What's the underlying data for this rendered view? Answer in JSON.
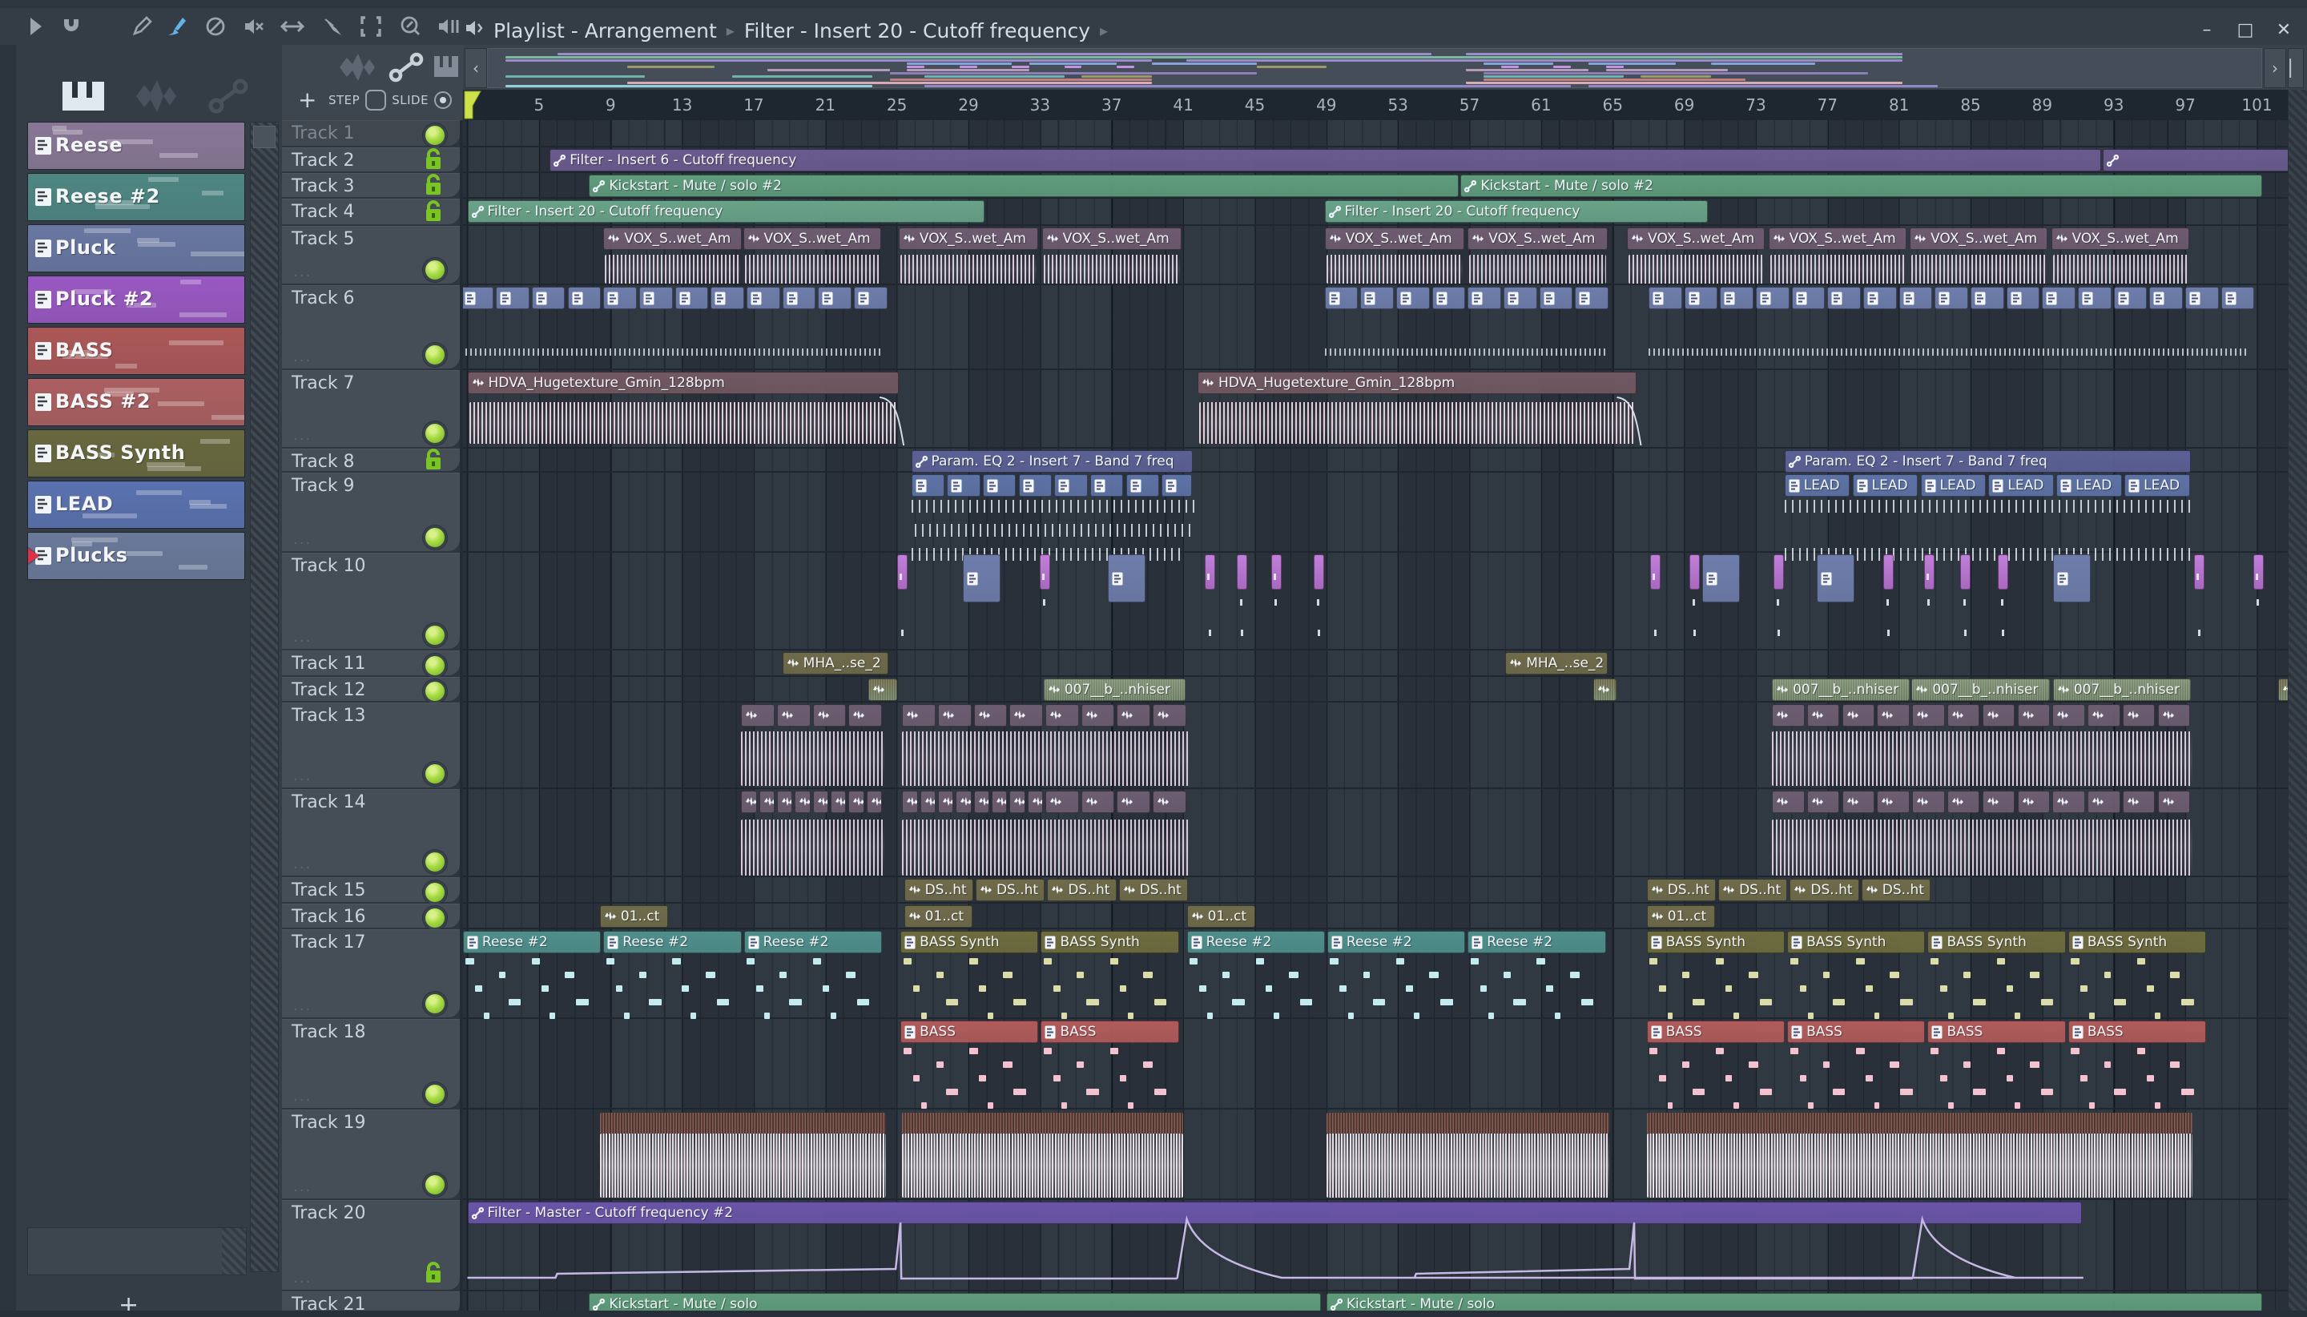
{
  "window": {
    "title_left": "Playlist - Arrangement",
    "title_right": "Filter - Insert 20 - Cutoff frequency",
    "controls": [
      "minimize",
      "maximize",
      "close"
    ]
  },
  "toolbar": {
    "icons": [
      "play",
      "magnet",
      "draw",
      "paint",
      "delete",
      "mute",
      "slip",
      "slice",
      "select",
      "zoom",
      "playback"
    ],
    "active_icon": "paint",
    "accent": "#63b3e8"
  },
  "corner": {
    "add_label": "+",
    "step_label": "STEP",
    "slide_label": "SLIDE",
    "icons": [
      "audio-wave",
      "automation-link",
      "piano"
    ],
    "slide_on": true,
    "step_on": false
  },
  "sidebar": {
    "header_icons": [
      "piano",
      "audio-wave",
      "automation-link"
    ],
    "patterns": [
      {
        "name": "Reese",
        "color": "#8d7a99"
      },
      {
        "name": "Reese #2",
        "color": "#4f8a85"
      },
      {
        "name": "Pluck",
        "color": "#6b7aa6"
      },
      {
        "name": "Pluck #2",
        "color": "#9e59c8"
      },
      {
        "name": "BASS",
        "color": "#b25858"
      },
      {
        "name": "BASS #2",
        "color": "#b26161"
      },
      {
        "name": "BASS Synth",
        "color": "#6b6a3d"
      },
      {
        "name": "LEAD",
        "color": "#5b74b4"
      },
      {
        "name": "Plucks",
        "color": "#6d7c9e",
        "playing": true
      }
    ]
  },
  "ruler": {
    "numbers": [
      5,
      9,
      13,
      17,
      21,
      25,
      29,
      33,
      37,
      41,
      45,
      49,
      53,
      57,
      61,
      65,
      69,
      73,
      77,
      81,
      85,
      89,
      93,
      97,
      101
    ]
  },
  "tracks": [
    {
      "name": "Track 1",
      "h": 34,
      "badge": "led",
      "dim": true
    },
    {
      "name": "Track 2",
      "h": 32,
      "badge": "lock"
    },
    {
      "name": "Track 3",
      "h": 32,
      "badge": "lock"
    },
    {
      "name": "Track 4",
      "h": 34,
      "badge": "lock"
    },
    {
      "name": "Track 5",
      "h": 74,
      "badge": "led-b",
      "dots": true
    },
    {
      "name": "Track 6",
      "h": 106,
      "badge": "led-b",
      "dots": true
    },
    {
      "name": "Track 7",
      "h": 98,
      "badge": "led-b",
      "dots": true
    },
    {
      "name": "Track 8",
      "h": 30,
      "badge": "lock"
    },
    {
      "name": "Track 9",
      "h": 100,
      "badge": "led-b",
      "dots": true
    },
    {
      "name": "Track 10",
      "h": 122,
      "badge": "led-b",
      "dots": true
    },
    {
      "name": "Track 11",
      "h": 33,
      "badge": "led"
    },
    {
      "name": "Track 12",
      "h": 32,
      "badge": "led"
    },
    {
      "name": "Track 13",
      "h": 108,
      "badge": "led-b",
      "dots": true
    },
    {
      "name": "Track 14",
      "h": 110,
      "badge": "led-b",
      "dots": true
    },
    {
      "name": "Track 15",
      "h": 33,
      "badge": "led"
    },
    {
      "name": "Track 16",
      "h": 32,
      "badge": "led"
    },
    {
      "name": "Track 17",
      "h": 112,
      "badge": "led-b",
      "dots": true
    },
    {
      "name": "Track 18",
      "h": 113,
      "badge": "led-b",
      "dots": true
    },
    {
      "name": "Track 19",
      "h": 113,
      "badge": "led-b",
      "dots": true
    },
    {
      "name": "Track 20",
      "h": 114,
      "badge": "lock-b",
      "dots": true
    },
    {
      "name": "Track 21",
      "h": 32,
      "badge": "none"
    }
  ],
  "palette": {
    "auto_purple": "#6a5b8e",
    "auto_green": "#5f9c7c",
    "auto_teal": "#69a388",
    "auto_blue": "#5b6195",
    "auto_master": "#6a55a8",
    "vox": "#6e5b70",
    "hdva": "#715862",
    "pattern_blue": "#6e7dab",
    "lead": "#5e73a6",
    "magenta": "#c07fd8",
    "olive": "#6f6b4a",
    "sage": "#7e8f74",
    "clip13": "#6d5d71",
    "reese": "#4f8f8c",
    "bass_synth": "#6e6c3e",
    "bass": "#b15b5b",
    "wav19_top": "#7a5a52",
    "note_cyan": "#c4ecf0",
    "note_olive": "#dcdca8",
    "note_pink": "#f4c2ce",
    "wave_pale": "#d8c8d8",
    "wave_pink": "#e3cdd8",
    "curve": "#cabcе8"
  },
  "clips": [
    {
      "t": 2,
      "k": "f6",
      "b": 5.6,
      "l": 86.8,
      "label": "Filter - Insert 6 - Cutoff frequency"
    },
    {
      "t": 2,
      "k": "f6",
      "b": 92.4,
      "l": 11.4,
      "label": ""
    },
    {
      "t": 3,
      "k": "ks",
      "b": 7.8,
      "l": 48.7,
      "label": "Kickstart - Mute / solo #2"
    },
    {
      "t": 3,
      "k": "ks",
      "b": 56.5,
      "l": 44.9,
      "label": "Kickstart - Mute / solo #2"
    },
    {
      "t": 4,
      "k": "f20",
      "b": 1.0,
      "l": 29.0,
      "label": "Filter - Insert 20 - Cutoff frequency"
    },
    {
      "t": 4,
      "k": "f20",
      "b": 48.9,
      "l": 21.5,
      "label": "Filter - Insert 20 - Cutoff frequency"
    },
    {
      "t": 5,
      "k": "vox",
      "b": 8.6,
      "count": 2,
      "step": 7.8,
      "l": 7.8,
      "label": "VOX_S..wet_Am"
    },
    {
      "t": 5,
      "k": "vox",
      "b": 25.1,
      "count": 2,
      "step": 8.0,
      "l": 7.9,
      "label": "VOX_S..wet_Am"
    },
    {
      "t": 5,
      "k": "vox",
      "b": 48.9,
      "count": 2,
      "step": 8.0,
      "l": 7.9,
      "label": "VOX_S..wet_Am"
    },
    {
      "t": 5,
      "k": "vox",
      "b": 65.8,
      "count": 4,
      "step": 7.9,
      "l": 7.8,
      "label": "VOX_S..wet_Am"
    },
    {
      "t": 6,
      "k": "pb",
      "b": 0.6,
      "count": 12,
      "step": 2,
      "l": 1.95
    },
    {
      "t": 6,
      "k": "pb",
      "b": 48.9,
      "count": 8,
      "step": 2,
      "l": 1.95
    },
    {
      "t": 6,
      "k": "pb",
      "b": 67.0,
      "count": 17,
      "step": 2,
      "l": 1.95
    },
    {
      "t": 6,
      "k": "dash6",
      "b": 0.6,
      "l": 23.6
    },
    {
      "t": 6,
      "k": "dash6",
      "b": 48.9,
      "l": 15.8
    },
    {
      "t": 6,
      "k": "dash6",
      "b": 67.0,
      "l": 33.5
    },
    {
      "t": 7,
      "k": "hdva",
      "b": 1.0,
      "l": 24.2,
      "label": "HDVA_Hugetexture_Gmin_128bpm"
    },
    {
      "t": 7,
      "k": "hdva",
      "b": 41.8,
      "l": 24.6,
      "label": "HDVA_Hugetexture_Gmin_128bpm"
    },
    {
      "t": 8,
      "k": "peq",
      "b": 25.8,
      "l": 15.8,
      "label": "Param. EQ 2 - Insert 7 - Band 7 freq"
    },
    {
      "t": 8,
      "k": "peq",
      "b": 74.6,
      "l": 22.8,
      "label": "Param. EQ 2 - Insert 7 - Band 7 freq"
    },
    {
      "t": 9,
      "k": "leadS",
      "b": 25.8,
      "count": 7,
      "step": 2,
      "l": 1.95
    },
    {
      "t": 9,
      "k": "lead",
      "b": 39.8,
      "l": 1.8,
      "label": "LEAD"
    },
    {
      "t": 9,
      "k": "lead",
      "b": 74.6,
      "count": 6,
      "step": 3.8,
      "l": 3.75,
      "label": "LEAD"
    },
    {
      "t": 9,
      "k": "tick9",
      "b": 25.8,
      "l": 15.8,
      "row": 0
    },
    {
      "t": 9,
      "k": "tick9",
      "b": 26.0,
      "l": 15.4,
      "row": 1
    },
    {
      "t": 9,
      "k": "tick9",
      "b": 25.8,
      "l": 15.0,
      "row": 2
    },
    {
      "t": 9,
      "k": "tick9",
      "b": 74.6,
      "l": 22.8,
      "row": 0
    },
    {
      "t": 9,
      "k": "tick9",
      "b": 74.6,
      "l": 22.8,
      "row": 2
    },
    {
      "t": 10,
      "k": "mgta",
      "b": 25.0,
      "l": 0.6
    },
    {
      "t": 10,
      "k": "mgta",
      "b": 33.0,
      "l": 0.6
    },
    {
      "t": 10,
      "k": "mgta",
      "b": 42.2,
      "l": 0.6
    },
    {
      "t": 10,
      "k": "mgta",
      "b": 44.0,
      "l": 0.6
    },
    {
      "t": 10,
      "k": "mgta",
      "b": 45.9,
      "l": 0.6
    },
    {
      "t": 10,
      "k": "mgta",
      "b": 48.3,
      "l": 0.6
    },
    {
      "t": 10,
      "k": "mgta",
      "b": 67.1,
      "l": 0.6
    },
    {
      "t": 10,
      "k": "mgta",
      "b": 69.3,
      "l": 0.6
    },
    {
      "t": 10,
      "k": "mgta",
      "b": 74.0,
      "l": 0.6
    },
    {
      "t": 10,
      "k": "mgta",
      "b": 80.1,
      "l": 0.6
    },
    {
      "t": 10,
      "k": "mgta",
      "b": 82.4,
      "l": 0.6
    },
    {
      "t": 10,
      "k": "mgta",
      "b": 84.4,
      "l": 0.6
    },
    {
      "t": 10,
      "k": "mgta",
      "b": 86.5,
      "l": 0.6
    },
    {
      "t": 10,
      "k": "mgta",
      "b": 97.5,
      "l": 0.6
    },
    {
      "t": 10,
      "k": "mgta",
      "b": 100.8,
      "l": 0.6
    },
    {
      "t": 10,
      "k": "pb10",
      "b": 28.7,
      "l": 2.2
    },
    {
      "t": 10,
      "k": "pb10",
      "b": 36.8,
      "l": 2.2
    },
    {
      "t": 10,
      "k": "pb10",
      "b": 70.0,
      "l": 2.2
    },
    {
      "t": 10,
      "k": "pb10",
      "b": 76.4,
      "l": 2.2
    },
    {
      "t": 10,
      "k": "pb10",
      "b": 89.6,
      "l": 2.2
    },
    {
      "t": 11,
      "k": "mha",
      "b": 18.6,
      "l": 6.0,
      "label": "MHA_..se_2"
    },
    {
      "t": 11,
      "k": "mha",
      "b": 59.0,
      "l": 5.8,
      "label": "MHA_..se_2"
    },
    {
      "t": 12,
      "k": "m007s",
      "b": 23.4,
      "l": 1.7
    },
    {
      "t": 12,
      "k": "m007s",
      "b": 63.9,
      "l": 1.4
    },
    {
      "t": 12,
      "k": "m007s",
      "b": 102.2,
      "l": 1.5
    },
    {
      "t": 12,
      "k": "m007",
      "b": 33.2,
      "l": 8.0,
      "label": "007__b_..nhiser"
    },
    {
      "t": 12,
      "k": "m007",
      "b": 73.9,
      "l": 7.8,
      "label": "007__b_..nhiser"
    },
    {
      "t": 12,
      "k": "m007",
      "b": 81.7,
      "l": 7.8,
      "label": "007__b_..nhiser"
    },
    {
      "t": 12,
      "k": "m007",
      "b": 89.6,
      "l": 7.8,
      "label": "007__b_..nhiser"
    },
    {
      "t": 13,
      "k": "c13",
      "b": 16.3,
      "count": 4,
      "step": 2,
      "l": 1.95
    },
    {
      "t": 13,
      "k": "c13",
      "b": 25.3,
      "count": 8,
      "step": 2,
      "l": 1.95
    },
    {
      "t": 13,
      "k": "c13",
      "b": 73.9,
      "count": 12,
      "step": 1.96,
      "l": 1.9
    },
    {
      "t": 13,
      "k": "w13",
      "b": 16.3,
      "l": 8.0
    },
    {
      "t": 13,
      "k": "w13",
      "b": 25.3,
      "l": 16.0
    },
    {
      "t": 13,
      "k": "w13",
      "b": 73.9,
      "l": 23.5
    },
    {
      "t": 14,
      "k": "c14",
      "b": 16.3,
      "count": 8,
      "step": 1,
      "l": 0.95
    },
    {
      "t": 14,
      "k": "c14",
      "b": 25.3,
      "count": 8,
      "step": 1,
      "l": 0.95
    },
    {
      "t": 14,
      "k": "c14",
      "b": 33.3,
      "count": 4,
      "step": 2,
      "l": 1.95
    },
    {
      "t": 14,
      "k": "c14",
      "b": 73.9,
      "count": 12,
      "step": 1.96,
      "l": 1.9
    },
    {
      "t": 14,
      "k": "w14",
      "b": 16.3,
      "l": 8.0
    },
    {
      "t": 14,
      "k": "w14",
      "b": 25.3,
      "l": 16.0
    },
    {
      "t": 14,
      "k": "w14",
      "b": 73.9,
      "l": 23.5
    },
    {
      "t": 15,
      "k": "ds",
      "b": 25.4,
      "count": 4,
      "step": 4,
      "l": 3.95,
      "label": "DS..ht"
    },
    {
      "t": 15,
      "k": "ds",
      "b": 66.9,
      "count": 4,
      "step": 4,
      "l": 3.95,
      "label": "DS..ht"
    },
    {
      "t": 16,
      "k": "ct",
      "b": 8.4,
      "l": 3.9,
      "label": "01..ct"
    },
    {
      "t": 16,
      "k": "ct",
      "b": 25.4,
      "l": 3.9,
      "label": "01..ct"
    },
    {
      "t": 16,
      "k": "ct",
      "b": 41.2,
      "l": 3.9,
      "label": "01..ct"
    },
    {
      "t": 16,
      "k": "ct",
      "b": 66.9,
      "l": 3.9,
      "label": "01..ct"
    },
    {
      "t": 17,
      "k": "reese",
      "b": 0.75,
      "count": 3,
      "step": 7.85,
      "l": 7.8,
      "label": "Reese #2"
    },
    {
      "t": 17,
      "k": "bsyn",
      "b": 25.2,
      "count": 2,
      "step": 7.85,
      "l": 7.8,
      "label": "BASS Synth"
    },
    {
      "t": 17,
      "k": "reese",
      "b": 41.2,
      "count": 3,
      "step": 7.85,
      "l": 7.8,
      "label": "Reese #2"
    },
    {
      "t": 17,
      "k": "bsyn",
      "b": 66.9,
      "count": 4,
      "step": 7.85,
      "l": 7.8,
      "label": "BASS Synth"
    },
    {
      "t": 18,
      "k": "bass",
      "b": 25.2,
      "count": 2,
      "step": 7.85,
      "l": 7.8,
      "label": "BASS"
    },
    {
      "t": 18,
      "k": "bass",
      "b": 66.9,
      "count": 4,
      "step": 7.85,
      "l": 7.8,
      "label": "BASS"
    },
    {
      "t": 19,
      "k": "w19",
      "b": 8.4,
      "l": 16.0
    },
    {
      "t": 19,
      "k": "w19",
      "b": 25.3,
      "l": 15.7
    },
    {
      "t": 19,
      "k": "w19",
      "b": 49.0,
      "l": 15.8
    },
    {
      "t": 19,
      "k": "w19",
      "b": 66.9,
      "l": 30.5
    },
    {
      "t": 20,
      "k": "fm",
      "b": 1.0,
      "l": 90.3,
      "label": "Filter - Master - Cutoff frequency #2"
    },
    {
      "t": 21,
      "k": "ksb",
      "b": 7.8,
      "l": 41.0,
      "label": "Kickstart - Mute / solo"
    },
    {
      "t": 21,
      "k": "ksb",
      "b": 49.0,
      "l": 52.4,
      "label": "Kickstart - Mute / solo"
    }
  ],
  "automation_curve": {
    "ramps": [
      {
        "from": 1.0,
        "to": 25.2
      },
      {
        "from": 49.0,
        "to": 66.2
      }
    ],
    "spikes": [
      {
        "bar": 41.2,
        "decay": 5.3
      },
      {
        "bar": 82.3,
        "decay": 5.2
      }
    ],
    "end_bar": 91.3
  },
  "minimap": {
    "rows": [
      {
        "y": 5,
        "c": "#9a8cc8",
        "seg": [
          [
            4,
            50
          ],
          [
            56,
            25
          ]
        ]
      },
      {
        "y": 9,
        "c": "#79b9a0",
        "seg": [
          [
            1,
            80
          ]
        ]
      },
      {
        "y": 13,
        "c": "#9a8cc8",
        "seg": [
          [
            1,
            37
          ],
          [
            40,
            41
          ]
        ]
      },
      {
        "y": 17,
        "c": "#85a3d8",
        "seg": [
          [
            24,
            6
          ],
          [
            31,
            5
          ],
          [
            38,
            6
          ],
          [
            57,
            4
          ],
          [
            63,
            5
          ],
          [
            70,
            6
          ]
        ]
      },
      {
        "y": 21,
        "c": "#c492e0",
        "seg": [
          [
            24,
            1
          ],
          [
            27,
            1
          ],
          [
            30,
            1
          ],
          [
            33,
            1
          ],
          [
            36,
            1
          ],
          [
            58,
            1
          ],
          [
            61,
            1
          ],
          [
            64,
            1
          ]
        ]
      },
      {
        "y": 21,
        "c": "#9a9a68",
        "seg": [
          [
            8,
            5
          ],
          [
            44,
            4
          ]
        ]
      },
      {
        "y": 25,
        "c": "#b29cba",
        "seg": [
          [
            16,
            7
          ],
          [
            24,
            7
          ],
          [
            56,
            7
          ],
          [
            64,
            7
          ]
        ]
      },
      {
        "y": 29,
        "c": "#8d7eb8",
        "seg": [
          [
            23,
            21
          ],
          [
            57,
            22
          ]
        ]
      },
      {
        "y": 33,
        "c": "#6fb4ac",
        "seg": [
          [
            1,
            8
          ],
          [
            14,
            8
          ],
          [
            25,
            8
          ],
          [
            57,
            8
          ]
        ]
      },
      {
        "y": 33,
        "c": "#9a9a68",
        "seg": [
          [
            34,
            4
          ],
          [
            66,
            4
          ]
        ]
      },
      {
        "y": 37,
        "c": "#c08080",
        "seg": [
          [
            23,
            15
          ],
          [
            57,
            15
          ]
        ]
      },
      {
        "y": 41,
        "c": "#d8aab8",
        "seg": [
          [
            8,
            30
          ],
          [
            56,
            25
          ]
        ]
      },
      {
        "y": 45,
        "c": "#90d0d8",
        "seg": [
          [
            1,
            21
          ]
        ]
      },
      {
        "y": 45,
        "c": "#9286c4",
        "seg": [
          [
            25,
            37
          ],
          [
            63,
            20
          ]
        ]
      }
    ]
  }
}
